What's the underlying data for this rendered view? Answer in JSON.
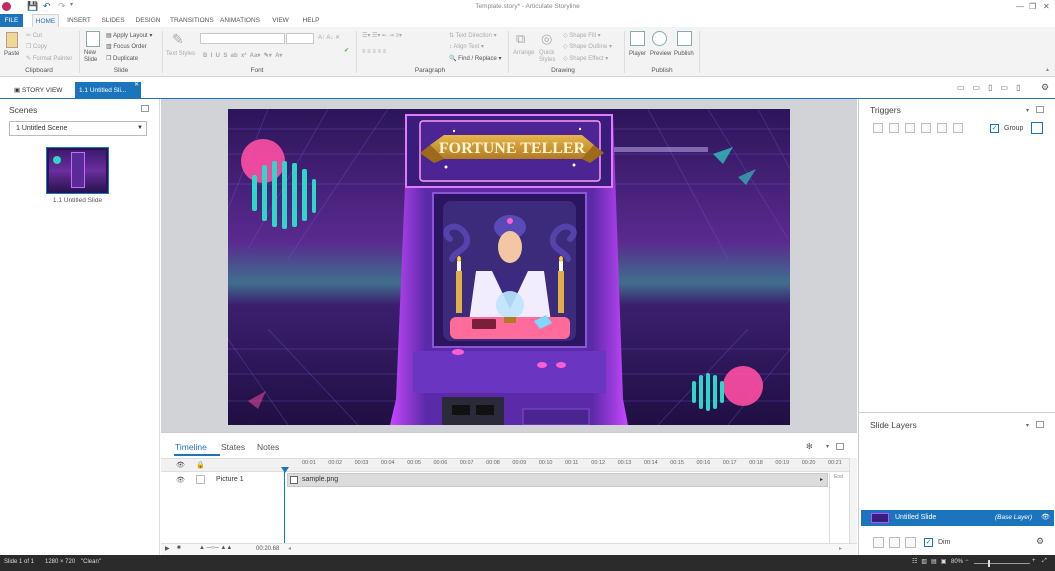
{
  "window": {
    "title": "Template.story* - Articulate Storyline"
  },
  "ribbon_tabs": [
    "FILE",
    "HOME",
    "INSERT",
    "SLIDES",
    "DESIGN",
    "TRANSITIONS",
    "ANIMATIONS",
    "VIEW",
    "HELP"
  ],
  "ribbon": {
    "clipboard": {
      "paste": "Paste",
      "cut": "Cut",
      "copy": "Copy",
      "format_painter": "Format Painter",
      "label": "Clipboard"
    },
    "slide": {
      "new_slide": "New Slide",
      "apply_layout": "Apply Layout",
      "focus_order": "Focus Order",
      "duplicate": "Duplicate",
      "label": "Slide"
    },
    "font": {
      "text_styles": "Text Styles",
      "label": "Font"
    },
    "paragraph": {
      "text_direction": "Text Direction",
      "align_text": "Align Text",
      "find_replace": "Find / Replace",
      "label": "Paragraph"
    },
    "drawing": {
      "arrange": "Arrange",
      "quick_styles": "Quick Styles",
      "shape_fill": "Shape Fill",
      "shape_outline": "Shape Outline",
      "shape_effect": "Shape Effect",
      "label": "Drawing"
    },
    "publish": {
      "player": "Player",
      "preview": "Preview",
      "publish": "Publish",
      "label": "Publish"
    }
  },
  "view_tabs": {
    "story_view": "STORY VIEW",
    "slide_tab": "1.1 Untitled Sli..."
  },
  "scenes": {
    "title": "Scenes",
    "selected_scene": "1 Untitled Scene",
    "thumb_label": "1.1 Untitled Slide"
  },
  "slide": {
    "banner_text": "FORTUNE TELLER"
  },
  "timeline": {
    "tabs": [
      "Timeline",
      "States",
      "Notes"
    ],
    "ticks": [
      "00:01",
      "00:02",
      "00:03",
      "00:04",
      "00:05",
      "00:06",
      "00:07",
      "00:08",
      "00:09",
      "00:10",
      "00:11",
      "00:12",
      "00:13",
      "00:14",
      "00:15",
      "00:16",
      "00:17",
      "00:18",
      "00:19",
      "00:20",
      "00:21"
    ],
    "row_name": "Picture 1",
    "bar_label": "sample.png",
    "end_label": "End",
    "duration": "00:20.68"
  },
  "triggers": {
    "title": "Triggers",
    "group_label": "Group"
  },
  "layers": {
    "title": "Slide Layers",
    "layer_name": "Untitled Slide",
    "layer_tag": "(Base Layer)",
    "dim_label": "Dim"
  },
  "status": {
    "slide": "Slide 1 of 1",
    "size": "1280 × 720",
    "state": "\"Clean\"",
    "zoom": "80%"
  },
  "colors": {
    "accent": "#1c75bc",
    "slide_bg": "#2a1552"
  }
}
